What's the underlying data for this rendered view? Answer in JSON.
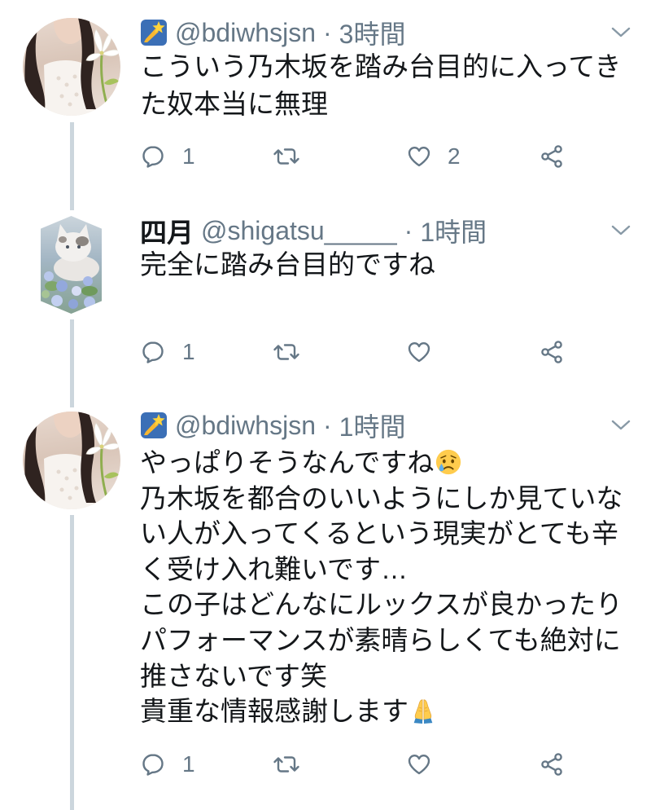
{
  "colors": {
    "background": "#ffffff",
    "text_primary": "#14171a",
    "text_secondary": "#657786",
    "icon": "#657786",
    "chevron": "#8899a6",
    "thread_line": "#ccd6dd"
  },
  "icons": {
    "reply": "reply-icon",
    "retweet": "retweet-icon",
    "like": "like-icon",
    "share": "share-icon",
    "menu": "chevron-down-icon"
  },
  "tweets": [
    {
      "name_emoji_icon": "shooting-star-emoji-icon",
      "handle": "@bdiwhsjsn",
      "separator": "·",
      "time": "3時間",
      "lines": [
        "こういう乃木坂を踏み台目的に入ってき",
        "た奴本当に無理"
      ],
      "reply_count": "1",
      "like_count": "2"
    },
    {
      "display_name": "四月",
      "handle": "@shigatsu_____",
      "separator": "·",
      "time": "1時間",
      "lines": [
        "完全に踏み台目的ですね"
      ],
      "reply_count": "1"
    },
    {
      "name_emoji_icon": "shooting-star-emoji-icon",
      "handle": "@bdiwhsjsn",
      "separator": "·",
      "time": "1時間",
      "lines": [
        "やっぱりそうなんですね",
        "乃木坂を都合のいいようにしか見ていな",
        "い人が入ってくるという現実がとても辛",
        "く受け入れ難いです…",
        "この子はどんなにルックスが良かったり",
        "パフォーマンスが素晴らしくても絶対に",
        "推さないです笑",
        "貴重な情報感謝します"
      ],
      "inline_emojis": [
        {
          "line": 0,
          "icon": "crying-face-emoji-icon"
        },
        {
          "line": 7,
          "icon": "folded-hands-emoji-icon"
        }
      ],
      "reply_count": "1"
    }
  ]
}
